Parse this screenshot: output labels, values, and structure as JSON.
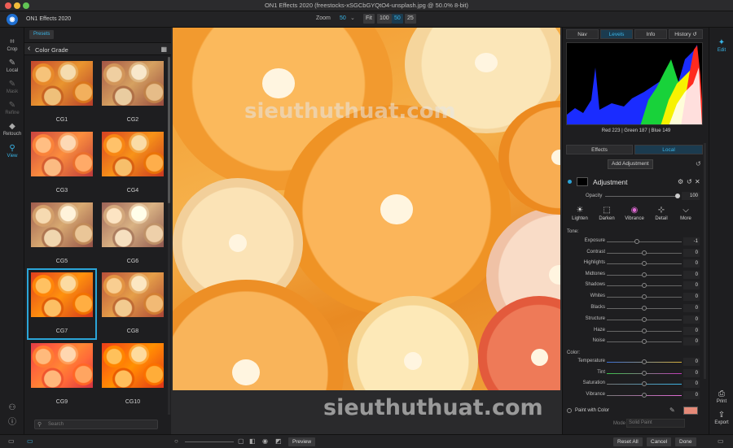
{
  "window": {
    "title": "ON1 Effects 2020 (freestocks-xSGCbGYQtO4-unsplash.jpg @ 50.0% 8-bit)"
  },
  "topbar": {
    "app_name": "ON1 Effects 2020",
    "zoom_label": "Zoom",
    "zoom_value": "50",
    "zoom_buttons": [
      "Fit",
      "100",
      "50",
      "25"
    ]
  },
  "tools": [
    {
      "label": "Crop",
      "icon": "crop-icon"
    },
    {
      "label": "Local",
      "icon": "brush-icon"
    },
    {
      "label": "Mask",
      "icon": "mask-brush-icon"
    },
    {
      "label": "Refine",
      "icon": "refine-brush-icon"
    },
    {
      "label": "Retouch",
      "icon": "eraser-icon"
    },
    {
      "label": "View",
      "icon": "magnifier-icon"
    }
  ],
  "presets": {
    "tab_label": "Presets",
    "category": "Color Grade",
    "items": [
      "CG1",
      "CG2",
      "CG3",
      "CG4",
      "CG5",
      "CG6",
      "CG7",
      "CG8",
      "CG9",
      "CG10"
    ],
    "selected": "CG7",
    "search_placeholder": "Search"
  },
  "canvas": {
    "watermark": "sieuthuthuat.com"
  },
  "footer_watermark": "sieuthuthuat.com",
  "right": {
    "tabs": [
      "Nav",
      "Levels",
      "Info",
      "History"
    ],
    "active_tab": "Levels",
    "rgb_readout": "Red 223 | Green 187 | Blue 149",
    "edit_tabs": [
      "Effects",
      "Local"
    ],
    "active_edit_tab": "Local",
    "add_adjustment": "Add Adjustment",
    "adjustment_title": "Adjustment",
    "opacity_label": "Opacity",
    "opacity_value": "100",
    "quick_buttons": [
      {
        "label": "Lighten",
        "icon": "sun-icon"
      },
      {
        "label": "Darken",
        "icon": "darken-icon"
      },
      {
        "label": "Vibrance",
        "icon": "color-wheel-icon"
      },
      {
        "label": "Detail",
        "icon": "detail-icon"
      },
      {
        "label": "More",
        "icon": "more-chevron-icon"
      }
    ],
    "tone_label": "Tone:",
    "tone_sliders": [
      {
        "label": "Exposure",
        "value": "-1"
      },
      {
        "label": "Contrast",
        "value": "0"
      },
      {
        "label": "Highlights",
        "value": "0"
      },
      {
        "label": "Midtones",
        "value": "0"
      },
      {
        "label": "Shadows",
        "value": "0"
      },
      {
        "label": "Whites",
        "value": "0"
      },
      {
        "label": "Blacks",
        "value": "0"
      }
    ],
    "detail_sliders": [
      {
        "label": "Structure",
        "value": "0"
      },
      {
        "label": "Haze",
        "value": "0"
      },
      {
        "label": "Noise",
        "value": "0"
      }
    ],
    "color_label": "Color:",
    "color_sliders": [
      {
        "label": "Temperature",
        "value": "0"
      },
      {
        "label": "Tint",
        "value": "0"
      },
      {
        "label": "Saturation",
        "value": "0"
      },
      {
        "label": "Vibrance",
        "value": "0"
      }
    ],
    "paint_with_color": "Paint with Color",
    "paint_color": "#e58a78",
    "mode_label": "Mode",
    "mode_value": "Solid Paint"
  },
  "modules": [
    {
      "label": "Edit",
      "icon": "edit-sliders-icon"
    },
    {
      "label": "Print",
      "icon": "printer-icon"
    },
    {
      "label": "Export",
      "icon": "export-icon"
    }
  ],
  "bottombar": {
    "preview": "Preview",
    "reset_all": "Reset All",
    "cancel": "Cancel",
    "done": "Done"
  },
  "colors": {
    "accent": "#39b4e6",
    "selection": "#2ba5d8",
    "background": "#1e1e20"
  }
}
